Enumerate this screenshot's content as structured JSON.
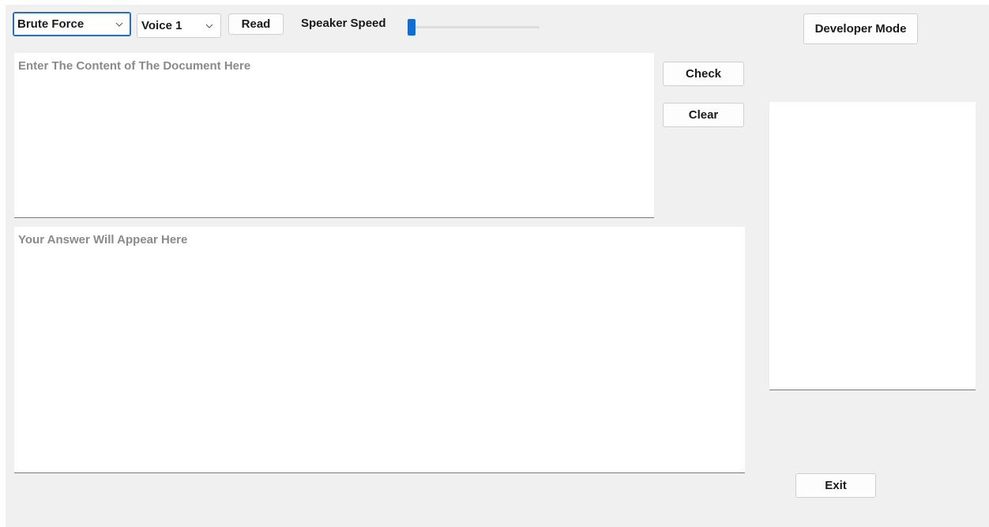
{
  "toolbar": {
    "algorithm_select": {
      "value": "Brute Force"
    },
    "voice_select": {
      "value": "Voice 1"
    },
    "read_label": "Read",
    "speed_label": "Speaker Speed",
    "speed_value": 0.03
  },
  "header": {
    "developer_mode_label": "Developer Mode"
  },
  "editor": {
    "document_placeholder": "Enter The Content of The Document Here",
    "answer_placeholder": "Your Answer Will Appear Here"
  },
  "actions": {
    "check_label": "Check",
    "clear_label": "Clear",
    "exit_label": "Exit"
  },
  "colors": {
    "accent": "#0a6fd8",
    "window_bg": "#f0f0f0"
  }
}
